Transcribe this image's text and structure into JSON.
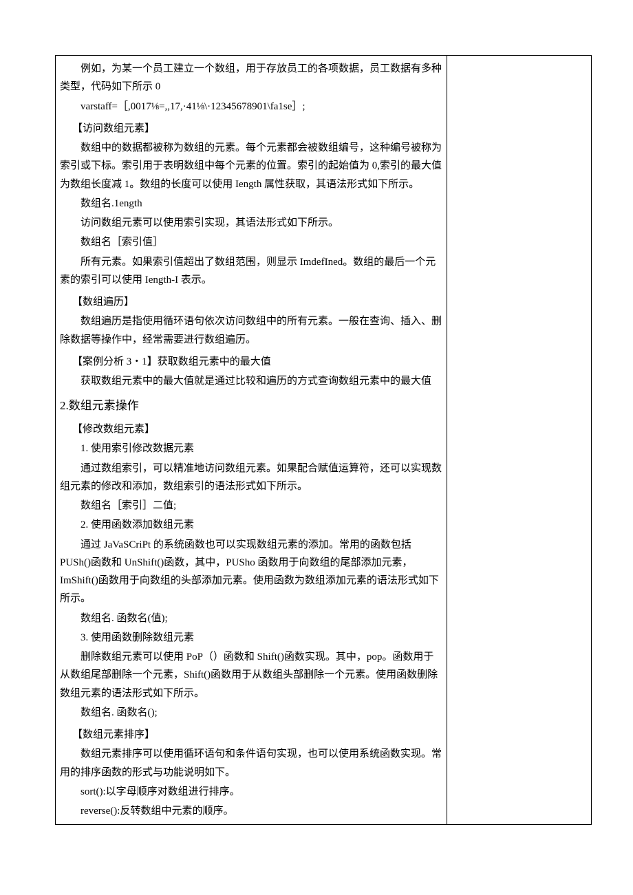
{
  "p1": "例如，为某一个员工建立一个数组，用于存放员工的各项数据，员工数据有多种类型，代码如下所示 0",
  "p2": "varstaff=［,0017⅛=,,17,·41⅛\\·12345678901\\fa1se］;",
  "sec1": "【访问数组元素】",
  "p3": "数组中的数据都被称为数组的元素。每个元素都会被数组编号，这种编号被称为索引或下标。索引用于表明数组中每个元素的位置。索引的起始值为 0,索引的最大值为数组长度减 1。数组的长度可以使用 Iength 属性获取，其语法形式如下所示。",
  "p4": "数组名.1ength",
  "p5": "访问数组元素可以使用索引实现，其语法形式如下所示。",
  "p6": "数组名［索引值］",
  "p7": "所有元素。如果索引值超出了数组范围，则显示 ImdefIned。数组的最后一个元素的索引可以使用 Iength-I 表示。",
  "sec2": "【数组遍历】",
  "p8": "数组遍历是指使用循环语句依次访问数组中的所有元素。一般在查询、插入、删除数据等操作中，经常需要进行数组遍历。",
  "sec3": "【案例分析 3・1】获取数组元素中的最大值",
  "p9": "获取数组元素中的最大值就是通过比较和遍历的方式查询数组元素中的最大值",
  "h2": "2.数组元素操作",
  "sec4": "【修改数组元素】",
  "p10": "1. 使用索引修改数据元素",
  "p11": "通过数组索引，可以精准地访问数组元素。如果配合赋值运算符，还可以实现数组元素的修改和添加，数组索引的语法形式如下所示。",
  "p12": "数组名［索引］二值;",
  "p13": "2. 使用函数添加数组元素",
  "p14": "通过 JaVaSCriPt 的系统函数也可以实现数组元素的添加。常用的函数包括PUSh()函数和 UnShift()函数，其中，PUSho 函数用于向数组的尾部添加元素，ImShift()函数用于向数组的头部添加元素。使用函数为数组添加元素的语法形式如下所示。",
  "p15": "数组名. 函数名(值);",
  "p16": "3. 使用函数删除数组元素",
  "p17": "删除数组元素可以使用 PoP（）函数和 Shift()函数实现。其中，pop。函数用于从数组尾部删除一个元素，Shift()函数用于从数组头部删除一个元素。使用函数删除数组元素的语法形式如下所示。",
  "p18": "数组名. 函数名();",
  "sec5": "【数组元素排序】",
  "p19": "数组元素排序可以使用循环语句和条件语句实现，也可以使用系统函数实现。常用的排序函数的形式与功能说明如下。",
  "p20": "sort():以字母顺序对数组进行排序。",
  "p21": "reverse():反转数组中元素的顺序。"
}
